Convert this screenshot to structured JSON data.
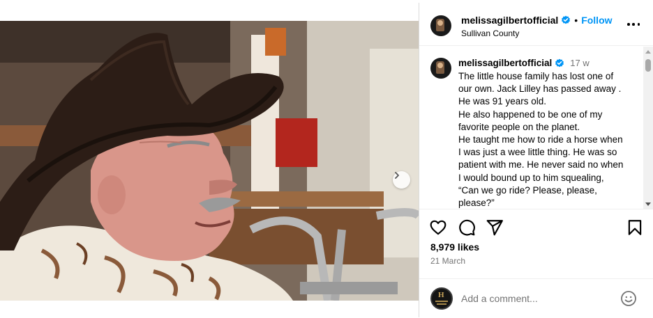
{
  "post": {
    "username": "melissagilbertofficial",
    "follow_label": "Follow",
    "dot": "•",
    "location": "Sullivan County",
    "caption_time": "17 w",
    "caption_lines": [
      "The little house family has lost one of",
      "our own. Jack Lilley has passed  away .",
      "He was 91 years old.",
      "He also happened to be one of my",
      "favorite people on the planet.",
      "He taught me how to ride a horse when",
      "I was just a wee little thing. He was so",
      "patient with me. He never said no when",
      "I would bound up to him squealing,",
      "“Can we go ride? Please, please,",
      "please?”"
    ],
    "likes": "8,979 likes",
    "date": "21 March"
  },
  "comment_box": {
    "placeholder": "Add a comment..."
  },
  "icons": {
    "more": "more-options-icon",
    "like": "heart-icon",
    "comment": "comment-bubble-icon",
    "share": "paper-plane-icon",
    "save": "bookmark-icon",
    "emoji": "smiley-icon",
    "next": "chevron-right-icon",
    "verified": "verified-badge-icon"
  },
  "colors": {
    "accent": "#0095f6",
    "verified": "#0095f6",
    "muted_text": "#737373",
    "divider": "#dbdbdb"
  }
}
